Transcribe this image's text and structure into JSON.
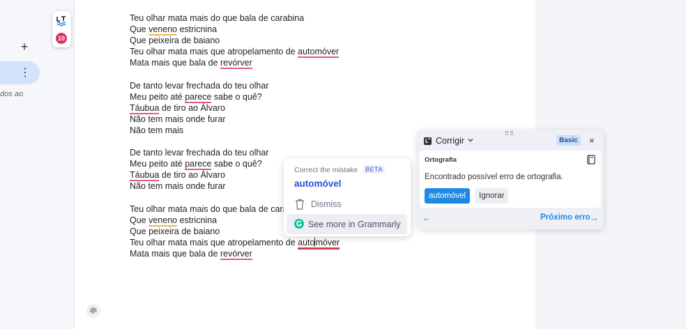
{
  "sidebar": {
    "add_label": "+",
    "more_label": "⋮",
    "truncated_text": "dos ao"
  },
  "lt_badge": {
    "error_count": "10"
  },
  "doc": {
    "l1": "Teu olhar mata mais do que bala de carabina",
    "l2_a": "Que ",
    "l2_u": "veneno",
    "l2_b": " estricnina",
    "l3": "Que peixeira de baiano",
    "l4_a": "Teu olhar mata mais que atropelamento de ",
    "l4_u": "automóver",
    "l5_a": "Mata mais que bala de ",
    "l5_u": "revórver",
    "l6": "De tanto levar frechada do teu olhar",
    "l7_a": "Meu peito até ",
    "l7_u": "parece",
    "l7_b": " sabe o quê?",
    "l8_u": "Táubua",
    "l8_b": " de tiro ao Álvaro",
    "l9": "Não tem mais onde furar",
    "l10": "Não tem mais",
    "l11": "De tanto levar frechada do teu olhar",
    "l12_a": "Meu peito até ",
    "l12_u": "parece",
    "l12_b": " sabe o quê?",
    "l13_u": "Táubua",
    "l13_b": " de tiro ao Álvaro",
    "l14": "Não tem mais onde furar",
    "l15": "Teu olhar mata mais do que bala de cara",
    "l16_a": "Que ",
    "l16_u": "veneno",
    "l16_b": " estricnina",
    "l17": "Que peixeira de baiano",
    "l18_a": "Teu olhar mata mais que atropelamento de ",
    "l18_u1": "auto",
    "l18_u2": "móver",
    "l19_a": "Mata mais que bala de ",
    "l19_u": "revórver"
  },
  "grammarly": {
    "header": "Correct the mistake",
    "beta": "BETA",
    "suggestion": "automóvel",
    "dismiss": "Dismiss",
    "see_more": "See more in Grammarly"
  },
  "languagetool": {
    "title": "Corrigir",
    "plan": "Basic",
    "close": "×",
    "category": "Ortografia",
    "message": "Encontrado possível erro de ortografia.",
    "suggestion": "automóvel",
    "ignore": "Ignorar",
    "prev_arrow": "←",
    "next_label": "Próximo erro",
    "next_arrow": "→",
    "grip": "⠿⠿"
  },
  "colors": {
    "accent_blue": "#1e88e5",
    "grammarly_blue": "#2b4fd8",
    "error_red": "#e35b75",
    "warning_orange": "#f0b44a",
    "badge_red": "#d93262"
  }
}
